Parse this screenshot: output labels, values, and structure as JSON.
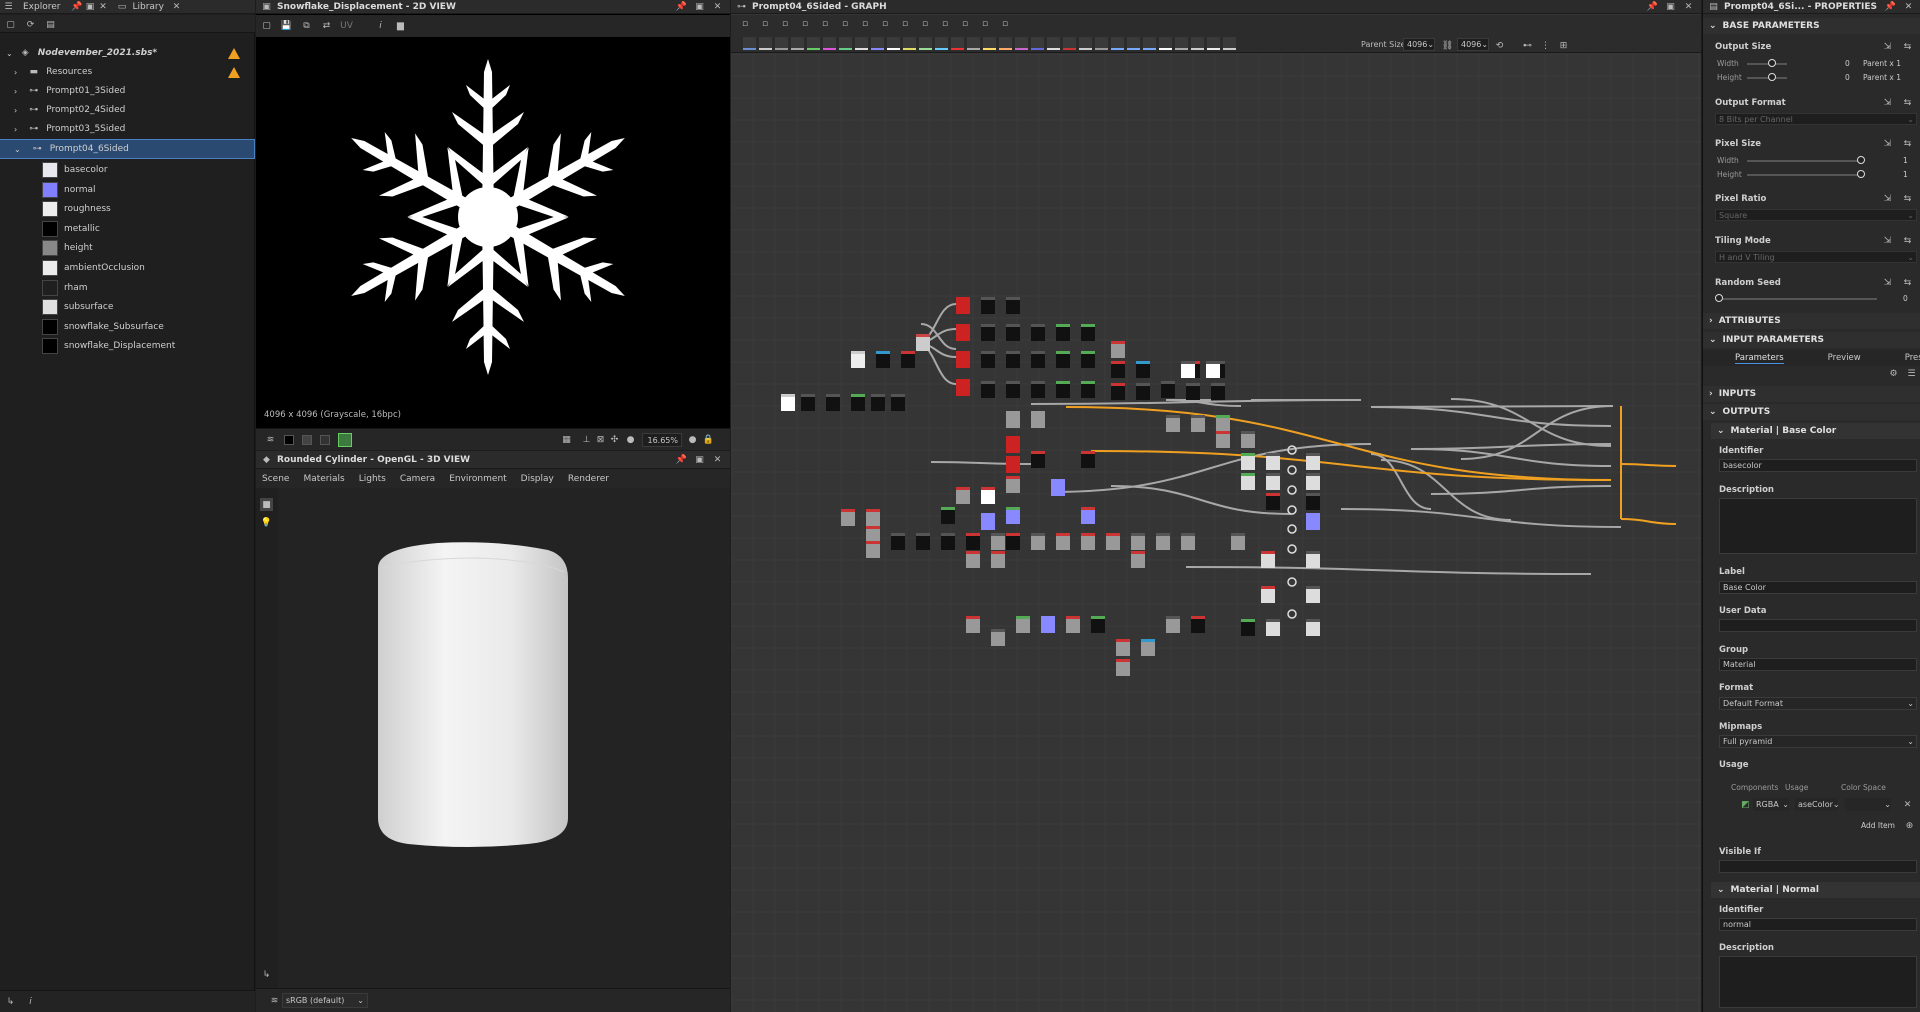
{
  "explorer": {
    "tabs": [
      "Explorer",
      "Library"
    ],
    "root": "Nodevember_2021.sbs*",
    "items": [
      {
        "label": "Resources"
      },
      {
        "label": "Prompt01_3Sided"
      },
      {
        "label": "Prompt02_4Sided"
      },
      {
        "label": "Prompt03_5Sided"
      },
      {
        "label": "Prompt04_6Sided"
      }
    ],
    "outputs": [
      {
        "label": "basecolor",
        "color": "#e8e8ee"
      },
      {
        "label": "normal",
        "color": "#8080ff"
      },
      {
        "label": "roughness",
        "color": "#eeeeee"
      },
      {
        "label": "metallic",
        "color": "#000000"
      },
      {
        "label": "height",
        "color": "#888888"
      },
      {
        "label": "ambientOcclusion",
        "color": "#ececec"
      },
      {
        "label": "rham",
        "color": "#1f1f1f"
      },
      {
        "label": "subsurface",
        "color": "#e0e0e0"
      },
      {
        "label": "snowflake_Subsurface",
        "color": "#000000"
      },
      {
        "label": "snowflake_Displacement",
        "color": "#000000"
      }
    ]
  },
  "view2d": {
    "title": "Snowflake_Displacement - 2D VIEW",
    "info": "4096 x 4096 (Grayscale, 16bpc)",
    "zoom": "16.65%"
  },
  "view3d": {
    "title": "Rounded Cylinder - OpenGL - 3D VIEW",
    "menu": [
      "Scene",
      "Materials",
      "Lights",
      "Camera",
      "Environment",
      "Display",
      "Renderer"
    ],
    "colorspace": "sRGB (default)"
  },
  "graph": {
    "title": "Prompt04_6Sided - GRAPH",
    "parent_size_label": "Parent Size:",
    "parent_size_1": "4096",
    "parent_size_2": "4096"
  },
  "props": {
    "title": "Prompt04_6Si... - PROPERTIES",
    "base_parameters": "BASE PARAMETERS",
    "output_size": "Output Size",
    "width_label": "Width",
    "height_label": "Height",
    "out_width_val": "0",
    "out_height_val": "0",
    "parent_x1a": "Parent x 1",
    "parent_x1b": "Parent x 1",
    "output_format": "Output Format",
    "output_format_val": "8 Bits per Channel",
    "pixel_size": "Pixel Size",
    "pix_width_val": "1",
    "pix_height_val": "1",
    "pixel_ratio": "Pixel Ratio",
    "pixel_ratio_val": "Square",
    "tiling_mode": "Tiling Mode",
    "tiling_mode_val": "H and V Tiling",
    "random_seed": "Random Seed",
    "random_seed_val": "0",
    "attributes": "ATTRIBUTES",
    "input_parameters": "INPUT PARAMETERS",
    "tabs": [
      "Parameters",
      "Preview",
      "Presets"
    ],
    "inputs": "INPUTS",
    "outputs": "OUTPUTS",
    "out1_title": "Material | Base Color",
    "identifier": "Identifier",
    "out1_identifier": "basecolor",
    "description": "Description",
    "label": "Label",
    "out1_label": "Base Color",
    "user_data": "User Data",
    "group": "Group",
    "out1_group": "Material",
    "format": "Format",
    "out1_format": "Default Format",
    "mipmaps": "Mipmaps",
    "out1_mipmaps": "Full pyramid",
    "usage": "Usage",
    "components": "Components",
    "usage_col": "Usage",
    "color_space": "Color Space",
    "usage_comp": "RGBA",
    "usage_val": "aseColor",
    "add_item": "Add Item",
    "visible_if": "Visible If",
    "out2_title": "Material | Normal",
    "out2_identifier": "normal"
  }
}
